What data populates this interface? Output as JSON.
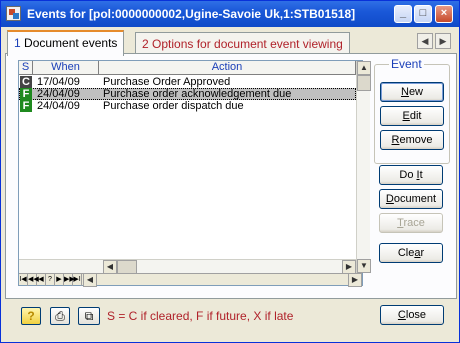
{
  "window": {
    "title": "Events for [pol:0000000002,Ugine-Savoie Uk,1:STB01518]"
  },
  "tabs": [
    {
      "num": "1",
      "label": "Document events"
    },
    {
      "num": "2",
      "label": "Options for document event viewing"
    }
  ],
  "grid": {
    "columns": {
      "status": "S",
      "when": "When",
      "action": "Action"
    },
    "rows": [
      {
        "status": "C",
        "status_color": "#444444",
        "when": "17/04/09",
        "action": "Purchase Order Approved"
      },
      {
        "status": "F",
        "status_color": "#1f8a1f",
        "when": "24/04/09",
        "action": "Purchase order acknowledgement due"
      },
      {
        "status": "F",
        "status_color": "#1f8a1f",
        "when": "24/04/09",
        "action": "Purchase order dispatch due"
      }
    ],
    "nav_buttons": [
      "first-icon",
      "prev-page-icon",
      "prev-icon",
      "help-nav-icon",
      "next-icon",
      "next-page-icon",
      "last-icon"
    ]
  },
  "event_group": {
    "title": "Event"
  },
  "buttons": {
    "new": {
      "acc": "N",
      "rest": "ew"
    },
    "edit": {
      "acc": "E",
      "rest": "dit"
    },
    "remove": {
      "acc": "R",
      "rest": "emove"
    },
    "doit": {
      "pre": "Do ",
      "acc": "I",
      "rest": "t"
    },
    "document": {
      "acc": "D",
      "rest": "ocument"
    },
    "trace": {
      "acc": "T",
      "rest": "race"
    },
    "clear": {
      "pre": "Cle",
      "acc": "a",
      "rest": "r"
    },
    "close": {
      "acc": "C",
      "rest": "lose"
    }
  },
  "legend": "S = C if cleared, F if future, X if late",
  "colors": {
    "accent": "#1a3fb8",
    "legend": "#b0222a",
    "titlebar": "#0f4ac8"
  }
}
